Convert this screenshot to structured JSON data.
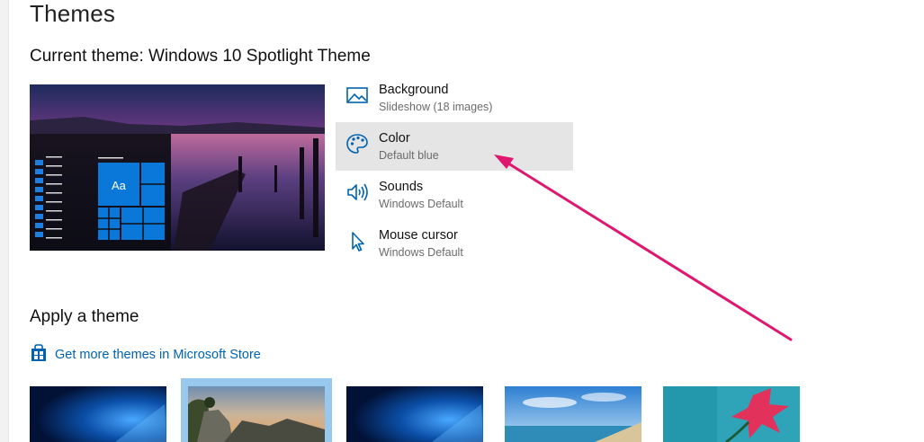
{
  "page": {
    "title": "Themes",
    "current_theme": "Current theme: Windows 10 Spotlight Theme"
  },
  "preview": {
    "sample_text": "Aa"
  },
  "settings": [
    {
      "title": "Background",
      "subtitle": "Slideshow (18 images)",
      "icon": "picture-icon"
    },
    {
      "title": "Color",
      "subtitle": "Default blue",
      "icon": "palette-icon"
    },
    {
      "title": "Sounds",
      "subtitle": "Windows Default",
      "icon": "speaker-icon"
    },
    {
      "title": "Mouse cursor",
      "subtitle": "Windows Default",
      "icon": "cursor-icon"
    }
  ],
  "apply": {
    "heading": "Apply a theme",
    "store_link": "Get more themes in Microsoft Store",
    "store_icon": "store-bag-icon"
  },
  "theme_thumbnails": [
    {
      "name": "windows-blue",
      "selected": false
    },
    {
      "name": "rock-landscape",
      "selected": true
    },
    {
      "name": "windows-blue-2",
      "selected": false
    },
    {
      "name": "beach",
      "selected": false
    },
    {
      "name": "pink-flower",
      "selected": false
    }
  ],
  "colors": {
    "accent": "#0078d7",
    "link": "#0063b1",
    "selected_item_bg": "#e5e5e5",
    "selected_thumb_border": "#99c8ee",
    "annotation_arrow": "#e0176e"
  }
}
